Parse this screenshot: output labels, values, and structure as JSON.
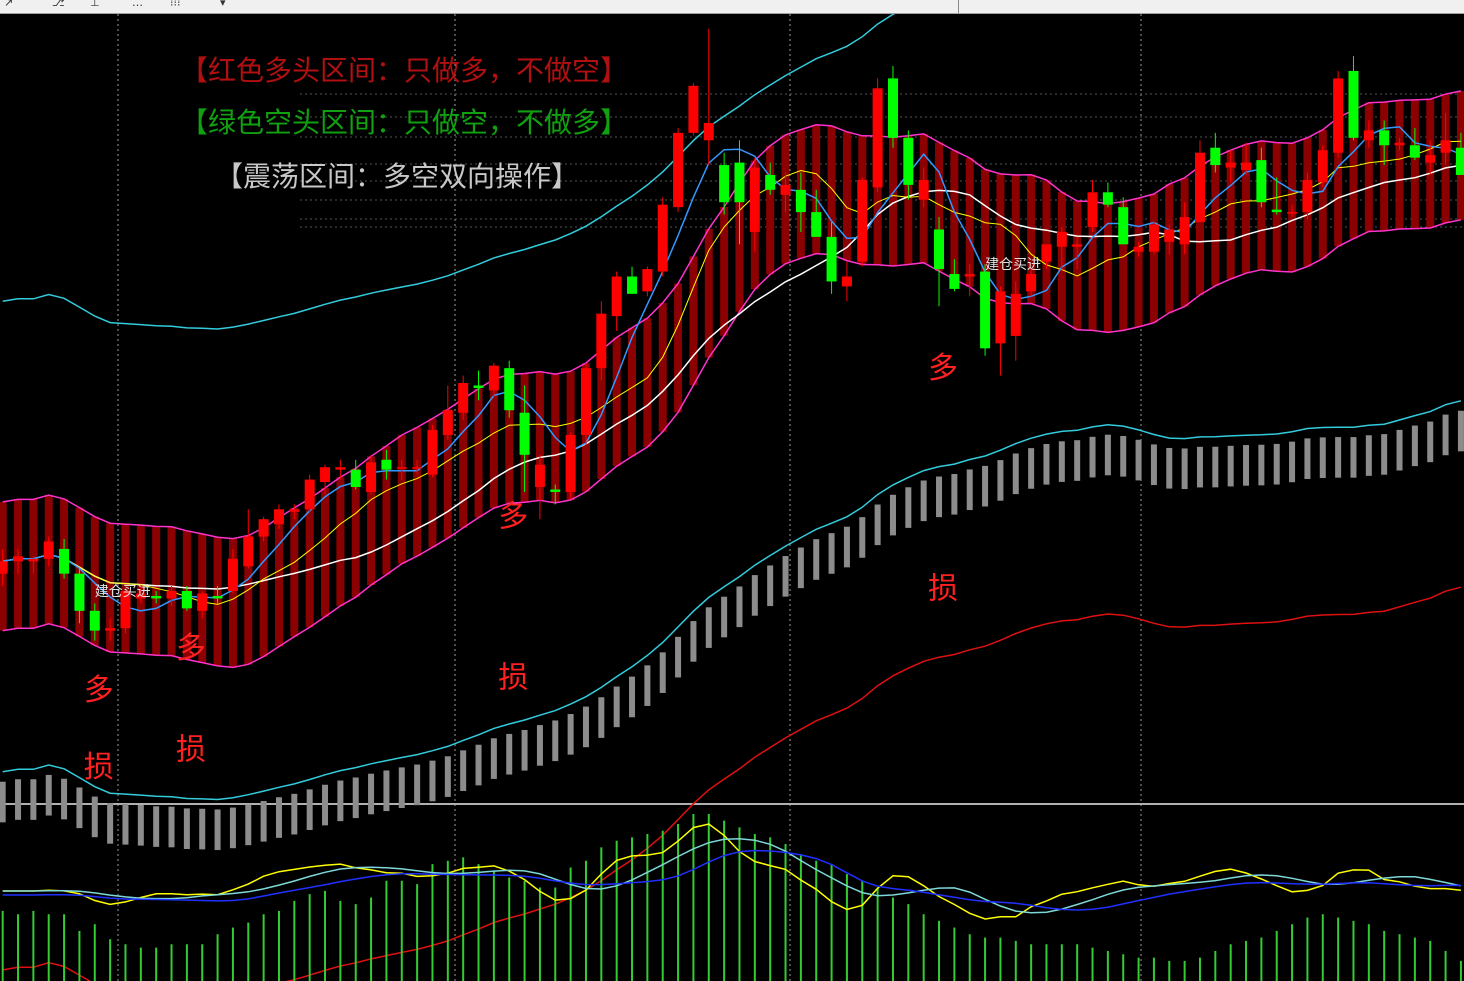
{
  "toolbar": {
    "icons": [
      "cursor-icon",
      "crosshair-icon",
      "line-tool-icon",
      "zoom-icon",
      "period-icon",
      "dropdown-icon"
    ],
    "glyphs": [
      "↗",
      "⎇",
      "⊥",
      "…",
      "⁝⁝⁝",
      "▾"
    ]
  },
  "colors": {
    "background": "#000000",
    "bull_candle": "#ff0000",
    "bear_candle": "#00ff00",
    "trend_band": "#8b0000",
    "band_border": "#ff33cc",
    "stop_band": "#8c8c8c",
    "ma_fast": "#3399ff",
    "ma_mid": "#ffff00",
    "ma_slow": "#ffffff",
    "channel": "#33ccdd",
    "long_ma": "#e01010",
    "volume": "#33cc33"
  },
  "chart_data": {
    "type": "candlestick",
    "title": "",
    "legend_texts": [
      {
        "text": "【红色多头区间：只做多，不做空】",
        "color": "#b01010"
      },
      {
        "text": "【绿色空头区间：只做空，不做多】",
        "color": "#10a010"
      },
      {
        "text": "【震荡区间：多空双向操作】",
        "color": "#c8c8c8"
      }
    ],
    "candles": [
      [
        48,
        49,
        47.5,
        48.5
      ],
      [
        48.5,
        49,
        48,
        48.7
      ],
      [
        48.5,
        48.7,
        48,
        48.6
      ],
      [
        48.6,
        49.5,
        48.3,
        49.3
      ],
      [
        49,
        49.4,
        47.8,
        48
      ],
      [
        48,
        48.2,
        46,
        46.5
      ],
      [
        46.5,
        46.8,
        45.3,
        45.7
      ],
      [
        45.7,
        46.2,
        45.3,
        45.8
      ],
      [
        45.8,
        47.5,
        45.6,
        47.3
      ],
      [
        47,
        47.5,
        46.8,
        47.2
      ],
      [
        47.1,
        47.3,
        46.8,
        47
      ],
      [
        47,
        47.5,
        46.7,
        47.3
      ],
      [
        47.3,
        47.5,
        46.5,
        46.6
      ],
      [
        46.5,
        47.3,
        46.2,
        47.2
      ],
      [
        47.1,
        47.5,
        46.8,
        47
      ],
      [
        47.3,
        49,
        47.2,
        48.6
      ],
      [
        48.3,
        50.6,
        48.2,
        49.5
      ],
      [
        49.5,
        50.3,
        49.3,
        50.2
      ],
      [
        50,
        50.8,
        49.8,
        50.6
      ],
      [
        50.5,
        50.8,
        50.2,
        50.6
      ],
      [
        50.6,
        52,
        50.5,
        51.8
      ],
      [
        51.7,
        52.4,
        51.2,
        52.3
      ],
      [
        52.2,
        52.6,
        51.8,
        52.3
      ],
      [
        52.2,
        52.6,
        51.4,
        51.5
      ],
      [
        51.3,
        52.8,
        51.2,
        52.5
      ],
      [
        52.6,
        53,
        51.8,
        52.2
      ],
      [
        52.3,
        52.6,
        51.8,
        52.3
      ],
      [
        52.3,
        52.6,
        52,
        52.3
      ],
      [
        52,
        54,
        51.9,
        53.8
      ],
      [
        53.6,
        55.6,
        53.4,
        54.6
      ],
      [
        54.5,
        56,
        54.2,
        55.7
      ],
      [
        55.6,
        56.2,
        55,
        55.5
      ],
      [
        55.4,
        56.5,
        55.1,
        56.4
      ],
      [
        56.3,
        56.6,
        54.3,
        54.6
      ],
      [
        54.5,
        55.6,
        51.3,
        52.8
      ],
      [
        51.5,
        52.8,
        50.2,
        52.4
      ],
      [
        51.4,
        51.6,
        50.8,
        51.3
      ],
      [
        51.3,
        53.7,
        51,
        53.6
      ],
      [
        53.6,
        56.5,
        53.2,
        56.3
      ],
      [
        56.3,
        59,
        55.8,
        58.5
      ],
      [
        58.4,
        60.2,
        57.8,
        60
      ],
      [
        60,
        60.4,
        59.8,
        59.3
      ],
      [
        59.4,
        60.4,
        59.2,
        60.3
      ],
      [
        60.2,
        63.2,
        60,
        62.9
      ],
      [
        62.8,
        66,
        62.6,
        65.8
      ],
      [
        65.8,
        67.8,
        65.7,
        67.7
      ],
      [
        65.5,
        70,
        64.5,
        66.2
      ],
      [
        64.5,
        65,
        62.5,
        63
      ],
      [
        64.6,
        65.5,
        61.3,
        63
      ],
      [
        61.8,
        64.8,
        61,
        64.4
      ],
      [
        64.1,
        64.6,
        63.3,
        63.5
      ],
      [
        63.3,
        64.2,
        62.6,
        63.7
      ],
      [
        63.5,
        64.2,
        61.8,
        62.6
      ],
      [
        62.6,
        63.5,
        61.8,
        61.6
      ],
      [
        61.6,
        62.2,
        59.3,
        59.8
      ],
      [
        59.6,
        60.6,
        59,
        60
      ],
      [
        60.6,
        64,
        60.4,
        63.9
      ],
      [
        63.6,
        68,
        63.4,
        67.6
      ],
      [
        68,
        68.5,
        65.2,
        65.6
      ],
      [
        65.6,
        65.9,
        63.1,
        63.7
      ],
      [
        63.1,
        64.4,
        62.8,
        63.9
      ],
      [
        61.9,
        62.4,
        58.8,
        60.3
      ],
      [
        60.1,
        60.7,
        59.4,
        59.5
      ],
      [
        60,
        60.5,
        59.2,
        60.1
      ],
      [
        60.2,
        60.5,
        56.8,
        57.1
      ],
      [
        57.3,
        59.6,
        56,
        59.4
      ],
      [
        57.6,
        59.8,
        56.6,
        59.3
      ],
      [
        59.4,
        60.4,
        59.2,
        60.1
      ],
      [
        60.6,
        61.3,
        60.3,
        61.3
      ],
      [
        61.2,
        62,
        60.2,
        61.8
      ],
      [
        61.2,
        61.6,
        60.3,
        61.3
      ],
      [
        62,
        63.9,
        61.8,
        63.4
      ],
      [
        63.4,
        63.8,
        62.8,
        62.9
      ],
      [
        62.8,
        63.2,
        61.3,
        61.3
      ],
      [
        61,
        61.4,
        60.8,
        61.2
      ],
      [
        61,
        62.2,
        60.9,
        62.1
      ],
      [
        61.4,
        62.1,
        60.9,
        61.9
      ],
      [
        61.3,
        63,
        60.9,
        62.4
      ],
      [
        62.2,
        65.5,
        62.2,
        65
      ],
      [
        65.2,
        65.8,
        64.2,
        64.5
      ],
      [
        64.4,
        65.1,
        63.8,
        64.6
      ],
      [
        64.3,
        65.4,
        64.1,
        64.6
      ],
      [
        64.7,
        65.2,
        62.8,
        63
      ],
      [
        62.7,
        64,
        62.5,
        62.6
      ],
      [
        62.6,
        62.9,
        62.4,
        62.6
      ],
      [
        62.6,
        64.2,
        62.3,
        63.9
      ],
      [
        63.8,
        65.3,
        63.6,
        65.1
      ],
      [
        65,
        68.3,
        64.8,
        68
      ],
      [
        68.3,
        68.9,
        65.5,
        65.6
      ],
      [
        65.5,
        66.3,
        65.2,
        65.9
      ],
      [
        65.9,
        66.3,
        64.5,
        65.3
      ],
      [
        65.3,
        65.6,
        65.1,
        65.4
      ],
      [
        65.3,
        66,
        64.7,
        64.8
      ],
      [
        64.6,
        65.5,
        64.1,
        64.9
      ],
      [
        65,
        66.6,
        64.5,
        65.5
      ],
      [
        65.2,
        65.8,
        64.2,
        64.1
      ]
    ],
    "price_range": [
      38.7,
      70.6
    ],
    "signals": [
      {
        "label": "多",
        "candle": 6,
        "price": 42.9,
        "color": "#ff2020"
      },
      {
        "label": "损",
        "candle": 6,
        "price": 39.8,
        "color": "#ff2020"
      },
      {
        "label": "多",
        "candle": 12,
        "price": 44.6,
        "color": "#ff2020"
      },
      {
        "label": "损",
        "candle": 12,
        "price": 40.5,
        "color": "#ff2020"
      },
      {
        "label": "多",
        "candle": 33,
        "price": 49.9,
        "color": "#ff2020"
      },
      {
        "label": "损",
        "candle": 33,
        "price": 43.4,
        "color": "#ff2020"
      },
      {
        "label": "多",
        "candle": 61,
        "price": 55.9,
        "color": "#ff2020"
      },
      {
        "label": "损",
        "candle": 61,
        "price": 47,
        "color": "#ff2020"
      }
    ],
    "small_labels": [
      {
        "text": "建仓买进",
        "candle": 6,
        "price": 47.1,
        "color": "#e0e0e0"
      },
      {
        "text": "建仓买进",
        "candle": 64,
        "price": 60.3,
        "color": "#e0e0e0"
      }
    ],
    "volume_range": [
      0,
      100
    ],
    "volume": [
      42,
      40,
      42,
      40,
      40,
      30,
      34,
      25,
      22,
      20,
      20,
      22,
      22,
      22,
      28,
      32,
      35,
      40,
      42,
      48,
      52,
      54,
      48,
      46,
      50,
      60,
      60,
      58,
      70,
      72,
      74,
      70,
      66,
      62,
      60,
      56,
      56,
      68,
      72,
      80,
      84,
      86,
      88,
      90,
      94,
      100,
      100,
      96,
      92,
      88,
      86,
      82,
      76,
      72,
      70,
      64,
      60,
      56,
      50,
      46,
      40,
      36,
      32,
      28,
      26,
      26,
      24,
      22,
      22,
      22,
      22,
      20,
      18,
      16,
      14,
      14,
      12,
      12,
      14,
      18,
      22,
      24,
      26,
      30,
      34,
      38,
      40,
      38,
      36,
      34,
      30,
      28,
      26,
      24,
      18,
      12
    ]
  }
}
